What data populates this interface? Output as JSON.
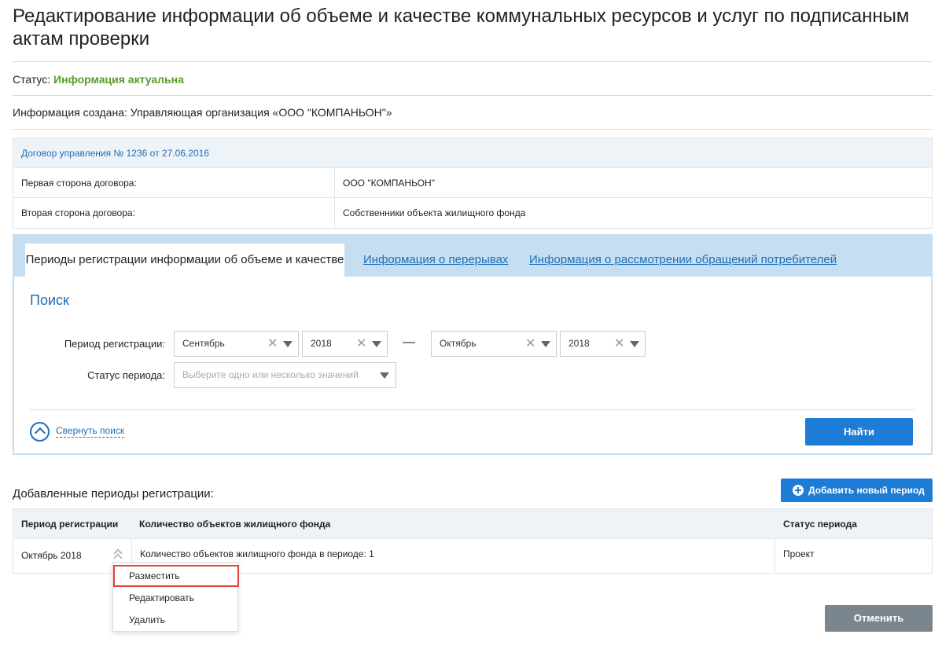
{
  "page": {
    "title": "Редактирование информации об объеме и качестве коммунальных ресурсов и услуг по подписанным актам проверки"
  },
  "status": {
    "label": "Статус: ",
    "value": "Информация актуальна",
    "value_color": "#5a9b2a"
  },
  "created": {
    "text": "Информация создана: Управляющая организация «ООО \"КОМПАНЬОН\"»"
  },
  "contract": {
    "header": "Договор управления № 1236 от 27.06.2016",
    "rows": [
      {
        "label": "Первая сторона договора:",
        "value": "ООО \"КОМПАНЬОН\""
      },
      {
        "label": "Вторая сторона договора:",
        "value": "Собственники объекта жилищного фонда"
      }
    ]
  },
  "tabs": [
    {
      "label": "Периоды регистрации информации об объеме и качестве",
      "active": true
    },
    {
      "label": "Информация о перерывах",
      "active": false
    },
    {
      "label": "Информация о рассмотрении обращений потребителей",
      "active": false
    }
  ],
  "search": {
    "title": "Поиск",
    "period_label": "Период регистрации:",
    "from_month": "Сентябрь",
    "from_year": "2018",
    "separator": "—",
    "to_month": "Октябрь",
    "to_year": "2018",
    "status_label": "Статус периода:",
    "status_placeholder": "Выберите одно или несколько значений",
    "collapse_label": "Свернуть поиск",
    "find_button": "Найти"
  },
  "periods": {
    "section_label": "Добавленные периоды регистрации:",
    "add_button": "Добавить новый период",
    "columns": [
      "Период регистрации",
      "Количество объектов жилищного фонда",
      "Статус периода"
    ],
    "rows": [
      {
        "period": "Октябрь 2018",
        "count_text": "Количество объектов жилищного фонда в периоде: 1",
        "status": "Проект"
      }
    ]
  },
  "context_menu": {
    "items": [
      "Разместить",
      "Редактировать",
      "Удалить"
    ]
  },
  "footer": {
    "cancel_button": "Отменить"
  },
  "colors": {
    "accent": "#1d7cd6",
    "link": "#1d6fb8",
    "highlight": "#e0443e",
    "cancel": "#7a858e"
  }
}
